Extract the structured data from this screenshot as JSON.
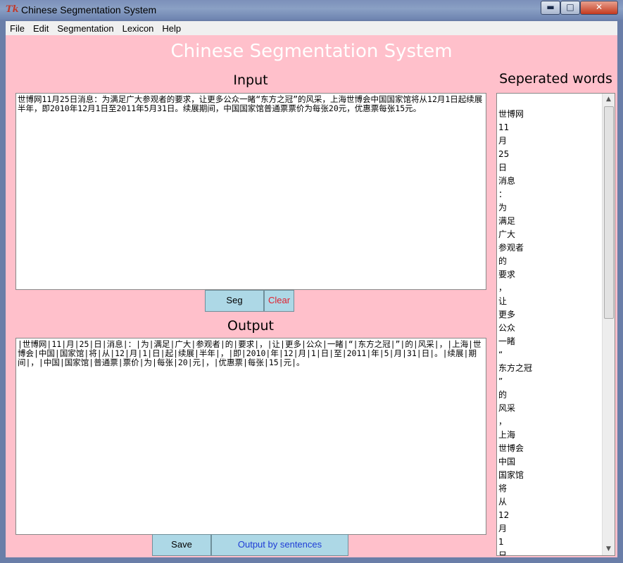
{
  "window": {
    "title": "Chinese Segmentation System",
    "minimize_glyph": "▬",
    "maximize_glyph": "□",
    "close_glyph": "✕",
    "logo_glyph": "Tk"
  },
  "menu": [
    "File",
    "Edit",
    "Segmentation",
    "Lexicon",
    "Help"
  ],
  "app_title": "Chinese Segmentation System",
  "input": {
    "label": "Input",
    "text": "世博网11月25日消息：为满足广大参观者的要求，让更多公众一睹“东方之冠”的风采，上海世博会中国国家馆将从12月1日起续展半年，即2010年12月1日至2011年5月31日。续展期间，中国国家馆普通票票价为每张20元，优惠票每张15元。"
  },
  "buttons": {
    "seg": "Seg",
    "clear": "Clear",
    "save": "Save",
    "output_by_sentences": "Output by sentences"
  },
  "output": {
    "label": "Output",
    "text": "|世博网|11|月|25|日|消息|：|为|满足|广大|参观者|的|要求|，|让|更多|公众|一睹|“|东方之冠|”|的|风采|，|上海|世博会|中国|国家馆|将|从|12|月|1|日|起|续展|半年|，|即|2010|年|12|月|1|日|至|2011|年|5|月|31|日|。|续展|期间|，|中国|国家馆|普通票|票价|为|每张|20|元|，|优惠票|每张|15|元|。"
  },
  "words_panel": {
    "label": "Seperated words",
    "items": [
      "世博网",
      "11",
      "月",
      "25",
      "日",
      "消息",
      "：",
      "为",
      "满足",
      "广大",
      "参观者",
      "的",
      "要求",
      "，",
      "让",
      "更多",
      "公众",
      "一睹",
      "“",
      "东方之冠",
      "”",
      "的",
      "风采",
      "，",
      "上海",
      "世博会",
      "中国",
      "国家馆",
      "将",
      "从",
      "12",
      "月",
      "1",
      "日"
    ]
  },
  "colors": {
    "background": "#ffc0cb",
    "button": "#add8e6",
    "clear_text": "#e0202e",
    "blue_text": "#1e3cd6",
    "title_text": "#ffffff"
  },
  "icons": {
    "scroll_up": "up-arrow-icon",
    "scroll_down": "down-arrow-icon"
  }
}
